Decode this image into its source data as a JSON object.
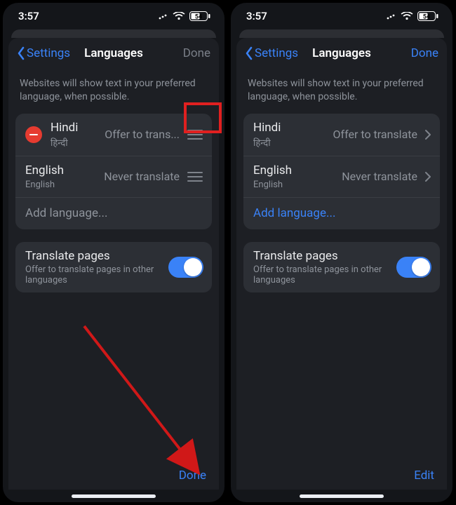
{
  "status": {
    "time": "3:57",
    "battery": "54"
  },
  "left": {
    "nav": {
      "back": "Settings",
      "title": "Languages",
      "done": "Done"
    },
    "hint": "Websites will show text in your preferred language, when possible.",
    "langs": [
      {
        "name": "Hindi",
        "native": "हिन्दी",
        "setting": "Offer to trans..."
      },
      {
        "name": "English",
        "native": "English",
        "setting": "Never translate"
      }
    ],
    "add": "Add language...",
    "translate": {
      "title": "Translate pages",
      "sub": "Offer to translate pages in other languages"
    },
    "toolbar": "Done"
  },
  "right": {
    "nav": {
      "back": "Settings",
      "title": "Languages",
      "done": "Done"
    },
    "hint": "Websites will show text in your preferred language, when possible.",
    "langs": [
      {
        "name": "Hindi",
        "native": "हिन्दी",
        "setting": "Offer to translate"
      },
      {
        "name": "English",
        "native": "English",
        "setting": "Never translate"
      }
    ],
    "add": "Add language...",
    "translate": {
      "title": "Translate pages",
      "sub": "Offer to translate pages in other languages"
    },
    "toolbar": "Edit"
  }
}
